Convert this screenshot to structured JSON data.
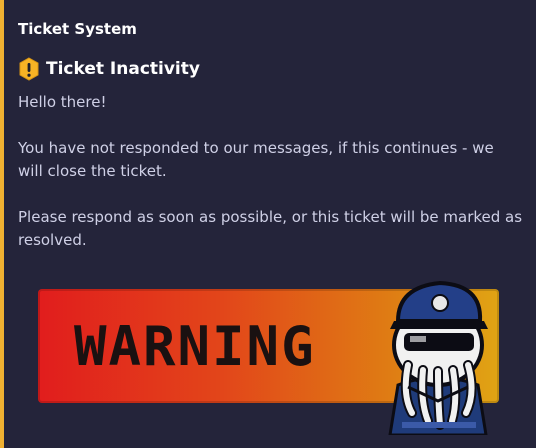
{
  "embed": {
    "accent_color": "#f0b132",
    "author": "Ticket System",
    "title_icon": "warning-icon",
    "title": "Ticket Inactivity",
    "description": [
      "Hello there!",
      "You have not responded to our messages, if this continues - we will close the ticket.",
      "Please respond as soon as possible, or this ticket will be marked as resolved."
    ]
  },
  "image": {
    "banner_text": "WARNING",
    "mascot": "police-officer-ghost-mascot"
  }
}
